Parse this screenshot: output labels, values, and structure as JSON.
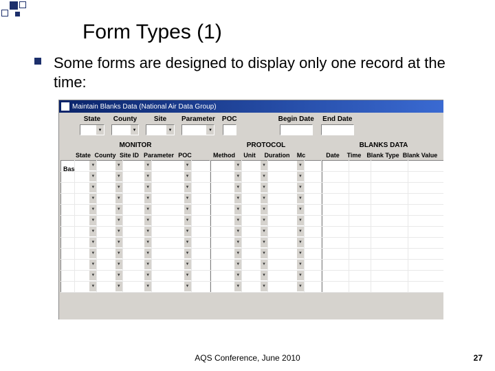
{
  "slide": {
    "title": "Form Types (1)",
    "bullet": "Some forms are designed to display only one record at the time:",
    "footer": "AQS Conference, June 2010",
    "page": "27"
  },
  "win": {
    "title": "Maintain Blanks Data (National Air Data Group)"
  },
  "filters": {
    "state": "State",
    "county": "County",
    "site": "Site",
    "parameter": "Parameter",
    "poc": "POC",
    "begin": "Begin Date",
    "end": "End Date"
  },
  "sections": {
    "monitor": "MONITOR",
    "protocol": "PROTOCOL",
    "blanks": "BLANKS DATA"
  },
  "mon_cols": {
    "state": "State",
    "county": "County",
    "site": "Site ID",
    "param": "Parameter",
    "poc": "POC"
  },
  "prot_cols": {
    "method": "Method",
    "unit": "Unit",
    "dur": "Duration",
    "mc": "Mc"
  },
  "blank_cols": {
    "date": "Date",
    "time": "Time",
    "btype": "Blank Type",
    "bval": "Blank Value"
  },
  "side": "Base CGra"
}
